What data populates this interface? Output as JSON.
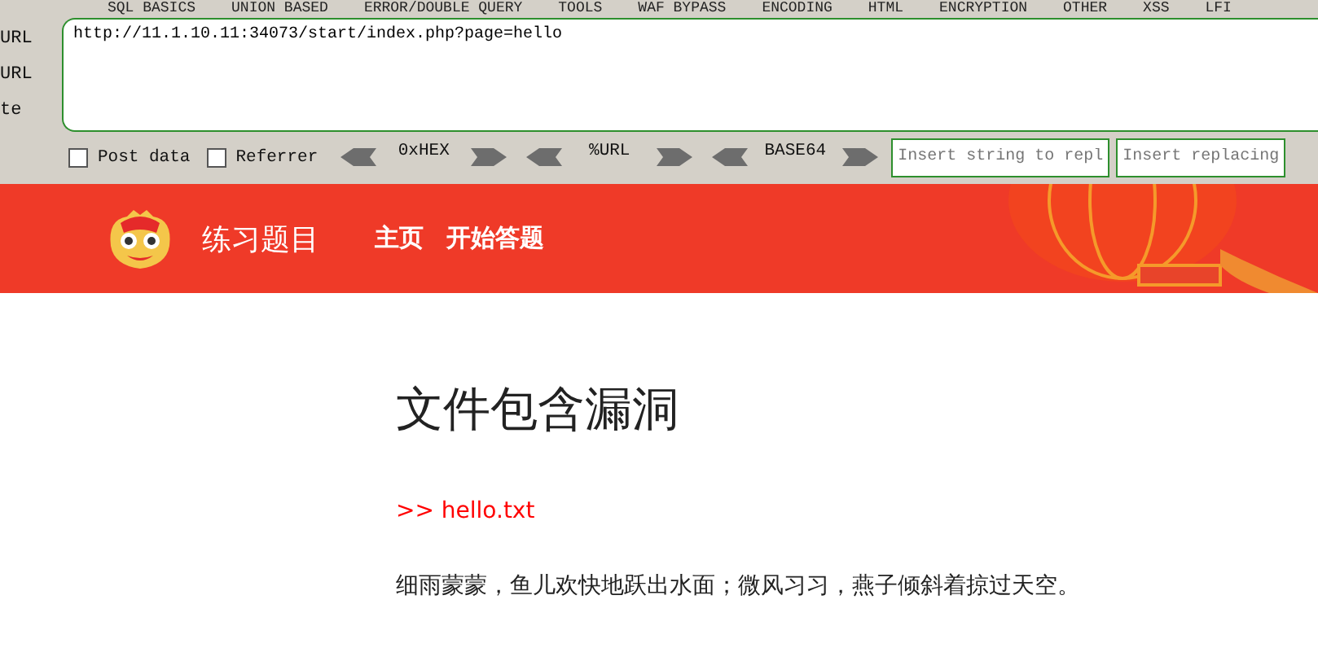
{
  "menu": [
    "SQL BASICS",
    "UNION BASED",
    "ERROR/DOUBLE QUERY",
    "TOOLS",
    "WAF BYPASS",
    "ENCODING",
    "HTML",
    "ENCRYPTION",
    "OTHER",
    "XSS",
    "LFI"
  ],
  "side_actions": [
    "URL",
    "URL",
    "te"
  ],
  "url_value": "http://11.1.10.11:34073/start/index.php?page=hello",
  "options": [
    {
      "label": "Post data",
      "checked": false
    },
    {
      "label": "Referrer",
      "checked": false
    }
  ],
  "encoders": [
    "0xHEX",
    "%URL",
    "BASE64"
  ],
  "replace_fields": [
    {
      "placeholder": "Insert string to repl"
    },
    {
      "placeholder": "Insert replacing"
    }
  ],
  "site": {
    "title": "练习题目",
    "nav": [
      "主页",
      "开始答题"
    ]
  },
  "content": {
    "heading": "文件包含漏洞",
    "include_line": ">> hello.txt",
    "paragraph": "细雨蒙蒙，鱼儿欢快地跃出水面；微风习习，燕子倾斜着掠过天空。"
  }
}
